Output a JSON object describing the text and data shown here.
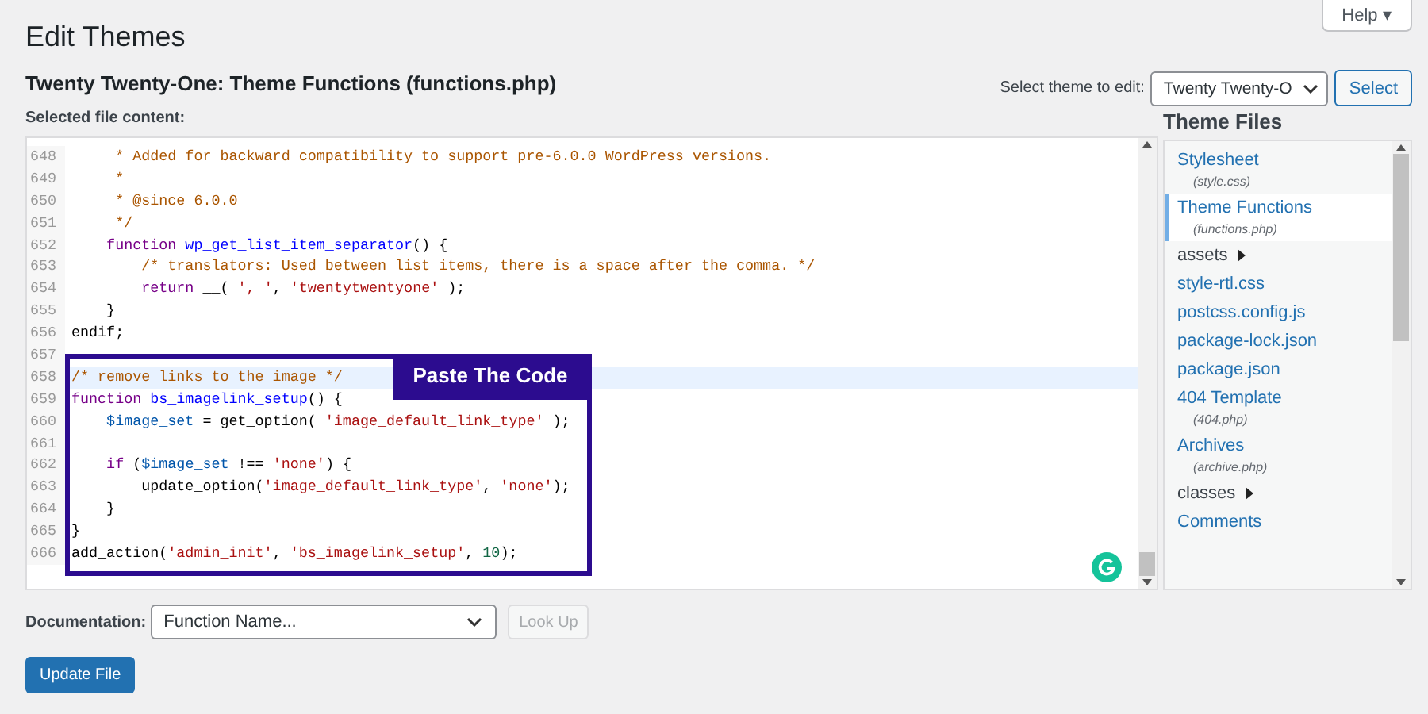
{
  "page_title": "Edit Themes",
  "help_button": "Help ▾",
  "file_title": "Twenty Twenty-One: Theme Functions (functions.php)",
  "theme_select": {
    "label": "Select theme to edit:",
    "value": "Twenty Twenty-O",
    "button": "Select"
  },
  "content_label": "Selected file content:",
  "code_lines": [
    {
      "number": "648",
      "active": false,
      "tokens": [
        {
          "kind": "comment",
          "text": "     * Added for backward compatibility to support pre-6.0.0 WordPress versions."
        }
      ]
    },
    {
      "number": "649",
      "active": false,
      "tokens": [
        {
          "kind": "comment",
          "text": "     *"
        }
      ]
    },
    {
      "number": "650",
      "active": false,
      "tokens": [
        {
          "kind": "comment",
          "text": "     * @since 6.0.0"
        }
      ]
    },
    {
      "number": "651",
      "active": false,
      "tokens": [
        {
          "kind": "comment",
          "text": "     */"
        }
      ]
    },
    {
      "number": "652",
      "active": false,
      "tokens": [
        {
          "kind": "keyword",
          "text": "    function"
        },
        {
          "kind": "def",
          "text": " wp_get_list_item_separator"
        },
        {
          "kind": "plain",
          "text": "() {"
        }
      ]
    },
    {
      "number": "653",
      "active": false,
      "tokens": [
        {
          "kind": "comment",
          "text": "        /* translators: Used between list items, there is a space after the comma. */"
        }
      ]
    },
    {
      "number": "654",
      "active": false,
      "tokens": [
        {
          "kind": "keyword",
          "text": "        return"
        },
        {
          "kind": "plain",
          "text": " __( "
        },
        {
          "kind": "string",
          "text": "', '"
        },
        {
          "kind": "plain",
          "text": ", "
        },
        {
          "kind": "string",
          "text": "'twentytwentyone'"
        },
        {
          "kind": "plain",
          "text": " );"
        }
      ]
    },
    {
      "number": "655",
      "active": false,
      "tokens": [
        {
          "kind": "plain",
          "text": "    }"
        }
      ]
    },
    {
      "number": "656",
      "active": false,
      "tokens": [
        {
          "kind": "plain",
          "text": "endif;"
        }
      ]
    },
    {
      "number": "657",
      "active": false
    },
    {
      "number": "658",
      "active": true,
      "tokens": [
        {
          "kind": "comment",
          "text": "/* remove links to the image */"
        }
      ]
    },
    {
      "number": "659",
      "active": false,
      "tokens": [
        {
          "kind": "keyword",
          "text": "function"
        },
        {
          "kind": "def",
          "text": " bs_imagelink_setup"
        },
        {
          "kind": "plain",
          "text": "() {"
        }
      ]
    },
    {
      "number": "660",
      "active": false,
      "tokens": [
        {
          "kind": "variable",
          "text": "    $image_set"
        },
        {
          "kind": "plain",
          "text": " = get_option( "
        },
        {
          "kind": "string",
          "text": "'image_default_link_type'"
        },
        {
          "kind": "plain",
          "text": " );"
        }
      ]
    },
    {
      "number": "661",
      "active": false
    },
    {
      "number": "662",
      "active": false,
      "tokens": [
        {
          "kind": "keyword",
          "text": "    if"
        },
        {
          "kind": "plain",
          "text": " ("
        },
        {
          "kind": "variable",
          "text": "$image_set"
        },
        {
          "kind": "plain",
          "text": " !== "
        },
        {
          "kind": "string",
          "text": "'none'"
        },
        {
          "kind": "plain",
          "text": ") {"
        }
      ]
    },
    {
      "number": "663",
      "active": false,
      "tokens": [
        {
          "kind": "plain",
          "text": "        update_option("
        },
        {
          "kind": "string",
          "text": "'image_default_link_type'"
        },
        {
          "kind": "plain",
          "text": ", "
        },
        {
          "kind": "string",
          "text": "'none'"
        },
        {
          "kind": "plain",
          "text": ");"
        }
      ]
    },
    {
      "number": "664",
      "active": false,
      "tokens": [
        {
          "kind": "plain",
          "text": "    }"
        }
      ]
    },
    {
      "number": "665",
      "active": false,
      "tokens": [
        {
          "kind": "plain",
          "text": "}"
        }
      ]
    },
    {
      "number": "666",
      "active": false,
      "tokens": [
        {
          "kind": "plain",
          "text": "add_action("
        },
        {
          "kind": "string",
          "text": "'admin_init'"
        },
        {
          "kind": "plain",
          "text": ", "
        },
        {
          "kind": "string",
          "text": "'bs_imagelink_setup'"
        },
        {
          "kind": "plain",
          "text": ", "
        },
        {
          "kind": "number",
          "text": "10"
        },
        {
          "kind": "plain",
          "text": ");"
        }
      ]
    }
  ],
  "callout": "Paste The Code",
  "sidebar": {
    "title": "Theme Files",
    "items": [
      {
        "kind": "file",
        "label": "Stylesheet",
        "filename": "(style.css)",
        "selected": false
      },
      {
        "kind": "file",
        "label": "Theme Functions",
        "filename": "(functions.php)",
        "selected": true
      },
      {
        "kind": "folder",
        "label": "assets",
        "selected": false
      },
      {
        "kind": "file",
        "label": "style-rtl.css",
        "selected": false
      },
      {
        "kind": "file",
        "label": "postcss.config.js",
        "selected": false
      },
      {
        "kind": "file",
        "label": "package-lock.json",
        "selected": false
      },
      {
        "kind": "file",
        "label": "package.json",
        "selected": false
      },
      {
        "kind": "file",
        "label": "404 Template",
        "filename": "(404.php)",
        "selected": false
      },
      {
        "kind": "file",
        "label": "Archives",
        "filename": "(archive.php)",
        "selected": false
      },
      {
        "kind": "folder",
        "label": "classes",
        "selected": false
      },
      {
        "kind": "file",
        "label": "Comments",
        "selected": false
      }
    ]
  },
  "documentation": {
    "label": "Documentation:",
    "placeholder": "Function Name...",
    "button": "Look Up",
    "button_disabled": true
  },
  "update_button": "Update File"
}
